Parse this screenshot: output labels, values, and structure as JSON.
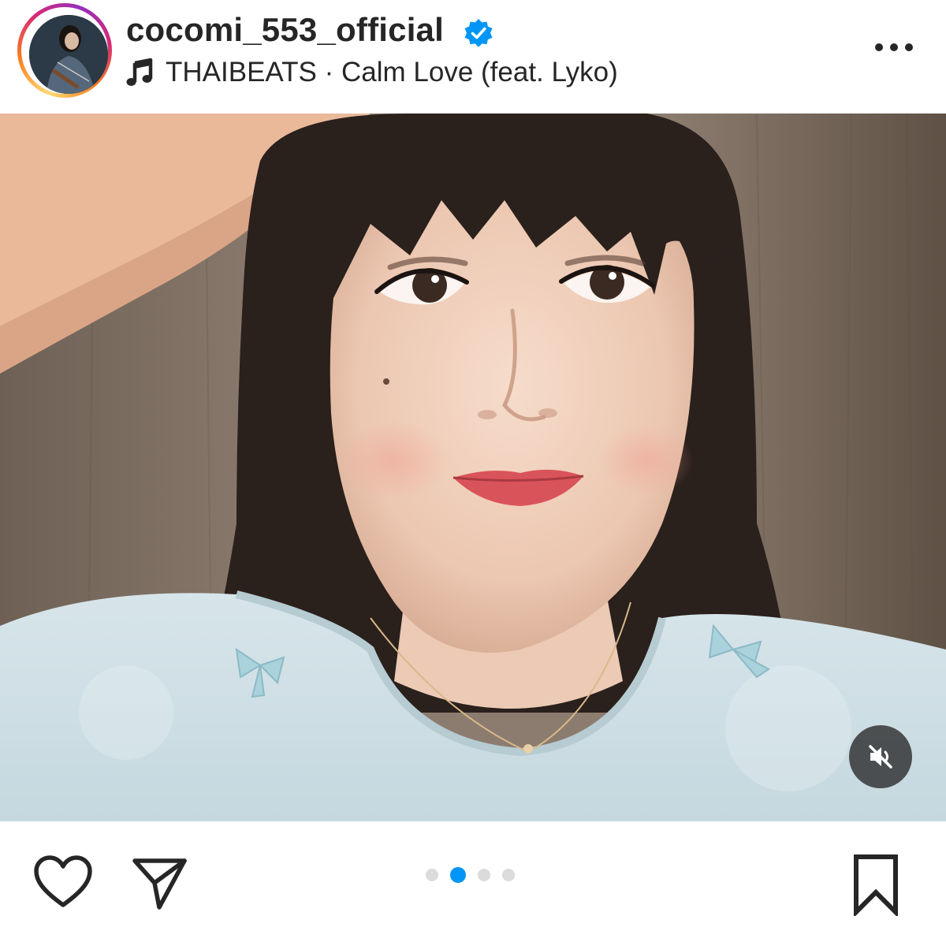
{
  "header": {
    "username": "cocomi_553_official",
    "verified": true,
    "verified_icon": "verified-badge-icon",
    "music_icon": "music-note-icon",
    "music_track": "THAIBEATS · Calm Love (feat. Lyko)",
    "more_icon": "more-options-icon"
  },
  "media": {
    "mute_icon": "speaker-muted-icon"
  },
  "actions": {
    "like_icon": "heart-icon",
    "share_icon": "paper-plane-icon",
    "save_icon": "bookmark-icon"
  },
  "carousel": {
    "total": 4,
    "active": 2
  },
  "colors": {
    "accent_blue": "#0095f6",
    "text": "#262626",
    "inactive_dot": "#dbdbdb",
    "ring_gradient": [
      "#feda75",
      "#fa7e1e",
      "#d62976",
      "#962fbf"
    ]
  }
}
